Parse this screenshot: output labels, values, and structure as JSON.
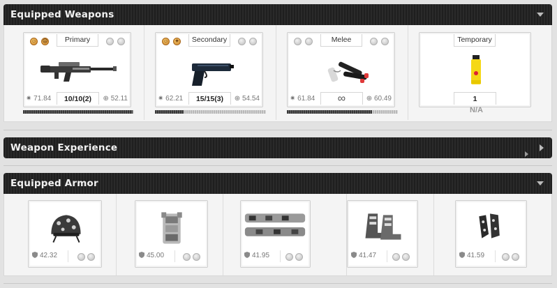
{
  "weapons_panel": {
    "title": "Equipped Weapons",
    "slots": [
      {
        "tab": "Primary",
        "stat_left": "71.84",
        "stat_right": "52.11",
        "ammo": "10/10(2)",
        "xp_fraction": 0.99,
        "badges": [
          "☺",
          "☹"
        ],
        "icon": "assault-rifle-icon"
      },
      {
        "tab": "Secondary",
        "stat_left": "62.21",
        "stat_right": "54.54",
        "ammo": "15/15(3)",
        "xp_fraction": 0.26,
        "badges": [
          "☺",
          "✦"
        ],
        "icon": "pistol-icon"
      },
      {
        "tab": "Melee",
        "stat_left": "61.84",
        "stat_right": "60.49",
        "ammo": "∞",
        "xp_fraction": 0.77,
        "badges": [],
        "icon": "nunchaku-icon"
      },
      {
        "tab": "Temporary",
        "ammo": "1",
        "na": "N/A",
        "icon": "pepper-spray-icon"
      }
    ]
  },
  "experience_panel": {
    "title": "Weapon Experience"
  },
  "armor_panel": {
    "title": "Equipped Armor",
    "slots": [
      {
        "value": "42.32",
        "icon": "helmet-icon"
      },
      {
        "value": "45.00",
        "icon": "body-armor-icon"
      },
      {
        "value": "41.95",
        "icon": "pants-icon"
      },
      {
        "value": "41.47",
        "icon": "boots-icon"
      },
      {
        "value": "41.59",
        "icon": "gloves-icon"
      }
    ]
  },
  "colors": {
    "header_bg": "#232323",
    "panel_bg": "#f4f4f4",
    "badge": "#e0a24a",
    "xp_bar": "#4a4a4a"
  }
}
